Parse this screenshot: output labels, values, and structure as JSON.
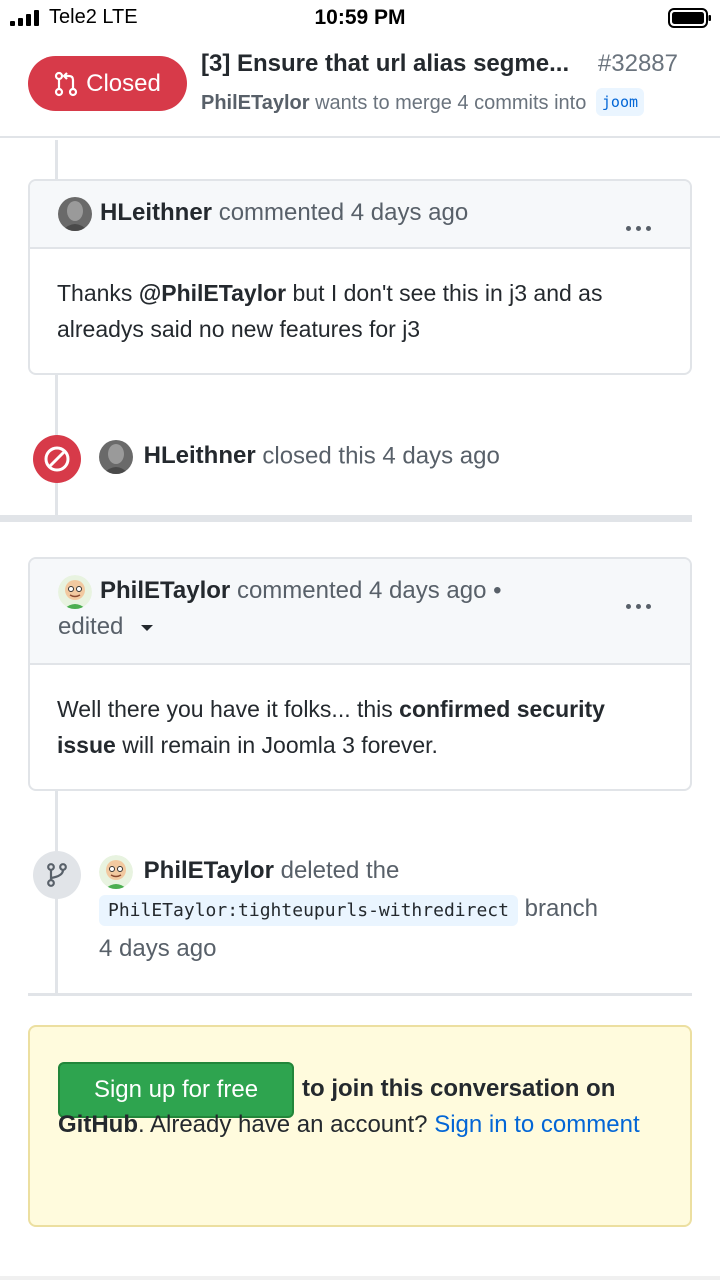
{
  "status_bar": {
    "carrier": "Tele2  LTE",
    "time": "10:59 PM"
  },
  "pr": {
    "state_label": "Closed",
    "state_color": "#d73a49",
    "title": "[3] Ensure that url alias segme...",
    "number": "#32887",
    "author": "PhilETaylor",
    "merge_text": "wants to merge 4 commits into",
    "target_branch": "joom"
  },
  "comment1": {
    "author": "HLeithner",
    "meta": "commented 4 days ago",
    "body_prefix": "Thanks ",
    "mention": "@PhilETaylor",
    "body_suffix": " but I don't see this in j3 and as alreadys said no new features for j3"
  },
  "close_event": {
    "actor": "HLeithner",
    "text": "closed this 4 days ago"
  },
  "comment2": {
    "author": "PhilETaylor",
    "meta": "commented 4 days ago •",
    "edited": "edited",
    "body_prefix": "Well there you have it folks... this ",
    "body_bold": "confirmed security issue",
    "body_suffix": " will remain in Joomla 3 forever."
  },
  "delete_event": {
    "actor": "PhilETaylor",
    "text": "deleted the",
    "branch": "PhilETaylor:tighteupurls-withredirect",
    "branch_suffix": "branch",
    "time": "4 days ago"
  },
  "signup": {
    "button": "Sign up for free",
    "text_bold": "to join this conversation on GitHub",
    "text_plain": ". Already have an account? ",
    "link": "Sign in to comment"
  }
}
